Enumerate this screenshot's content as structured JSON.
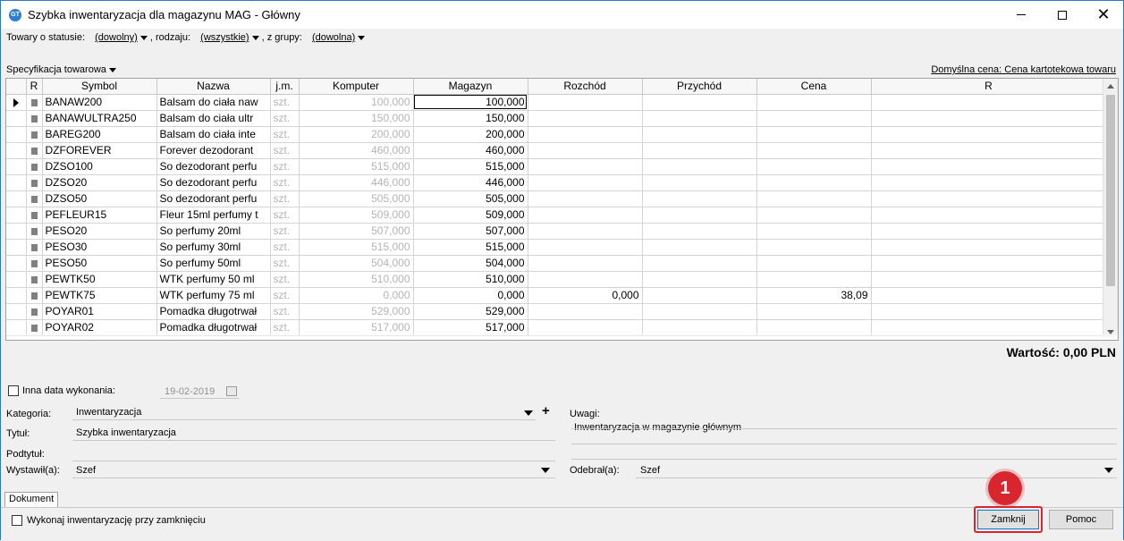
{
  "window": {
    "title": "Szybka inwentaryzacja dla magazynu MAG - Główny",
    "icon": "GT"
  },
  "filters": {
    "status_label": "Towary o statusie:",
    "status_value": "(dowolny)",
    "kind_label": ", rodzaju:",
    "kind_value": "(wszystkie)",
    "group_label": ", z grupy:",
    "group_value": "(dowolna)"
  },
  "spec_label": "Specyfikacja towarowa",
  "default_price": "Domyślna cena: Cena kartotekowa towaru",
  "grid": {
    "columns": [
      "R",
      "Symbol",
      "Nazwa",
      "j.m.",
      "Komputer",
      "Magazyn",
      "Rozchód",
      "Przychód",
      "Cena",
      "R"
    ],
    "rows": [
      {
        "symbol": "BANAW200",
        "name": "Balsam do ciała naw",
        "unit": "szt.",
        "computer": "100,000",
        "warehouse": "100,000",
        "out": "",
        "in": "",
        "price": ""
      },
      {
        "symbol": "BANAWULTRA250",
        "name": "Balsam do ciała ultr",
        "unit": "szt.",
        "computer": "150,000",
        "warehouse": "150,000",
        "out": "",
        "in": "",
        "price": ""
      },
      {
        "symbol": "BAREG200",
        "name": "Balsam do ciała inte",
        "unit": "szt.",
        "computer": "200,000",
        "warehouse": "200,000",
        "out": "",
        "in": "",
        "price": ""
      },
      {
        "symbol": "DZFOREVER",
        "name": "Forever dezodorant",
        "unit": "szt.",
        "computer": "460,000",
        "warehouse": "460,000",
        "out": "",
        "in": "",
        "price": ""
      },
      {
        "symbol": "DZSO100",
        "name": "So dezodorant perfu",
        "unit": "szt.",
        "computer": "515,000",
        "warehouse": "515,000",
        "out": "",
        "in": "",
        "price": ""
      },
      {
        "symbol": "DZSO20",
        "name": "So dezodorant perfu",
        "unit": "szt.",
        "computer": "446,000",
        "warehouse": "446,000",
        "out": "",
        "in": "",
        "price": ""
      },
      {
        "symbol": "DZSO50",
        "name": "So dezodorant perfu",
        "unit": "szt.",
        "computer": "505,000",
        "warehouse": "505,000",
        "out": "",
        "in": "",
        "price": ""
      },
      {
        "symbol": "PEFLEUR15",
        "name": "Fleur 15ml perfumy t",
        "unit": "szt.",
        "computer": "509,000",
        "warehouse": "509,000",
        "out": "",
        "in": "",
        "price": ""
      },
      {
        "symbol": "PESO20",
        "name": "So perfumy 20ml",
        "unit": "szt.",
        "computer": "507,000",
        "warehouse": "507,000",
        "out": "",
        "in": "",
        "price": ""
      },
      {
        "symbol": "PESO30",
        "name": "So perfumy 30ml",
        "unit": "szt.",
        "computer": "515,000",
        "warehouse": "515,000",
        "out": "",
        "in": "",
        "price": ""
      },
      {
        "symbol": "PESO50",
        "name": "So perfumy 50ml",
        "unit": "szt.",
        "computer": "504,000",
        "warehouse": "504,000",
        "out": "",
        "in": "",
        "price": ""
      },
      {
        "symbol": "PEWTK50",
        "name": "WTK perfumy 50 ml",
        "unit": "szt.",
        "computer": "510,000",
        "warehouse": "510,000",
        "out": "",
        "in": "",
        "price": ""
      },
      {
        "symbol": "PEWTK75",
        "name": "WTK perfumy 75 ml",
        "unit": "szt.",
        "computer": "0,000",
        "warehouse": "0,000",
        "out": "0,000",
        "in": "",
        "price": "38,09"
      },
      {
        "symbol": "POYAR01",
        "name": "Pomadka długotrwał",
        "unit": "szt.",
        "computer": "529,000",
        "warehouse": "529,000",
        "out": "",
        "in": "",
        "price": ""
      },
      {
        "symbol": "POYAR02",
        "name": "Pomadka długotrwał",
        "unit": "szt.",
        "computer": "517,000",
        "warehouse": "517,000",
        "out": "",
        "in": "",
        "price": ""
      }
    ]
  },
  "total": "Wartość: 0,00 PLN",
  "form": {
    "other_date_label": "Inna data wykonania:",
    "other_date_value": "19-02-2019",
    "category_label": "Kategoria:",
    "category_value": "Inwentaryzacja",
    "title_label": "Tytuł:",
    "title_value": "Szybka inwentaryzacja",
    "subtitle_label": "Podtytuł:",
    "subtitle_value": "",
    "issued_label": "Wystawił(a):",
    "issued_value": "Szef",
    "notes_label": "Uwagi:",
    "notes_value": "Inwentaryzacja w magazynie głównym",
    "received_label": "Odebrał(a):",
    "received_value": "Szef"
  },
  "tab_label": "Dokument",
  "execute_label": "Wykonaj inwentaryzację przy zamknięciu",
  "buttons": {
    "close": "Zamknij",
    "help": "Pomoc"
  },
  "annotation": {
    "step": "1",
    "color": "#d9262e"
  }
}
